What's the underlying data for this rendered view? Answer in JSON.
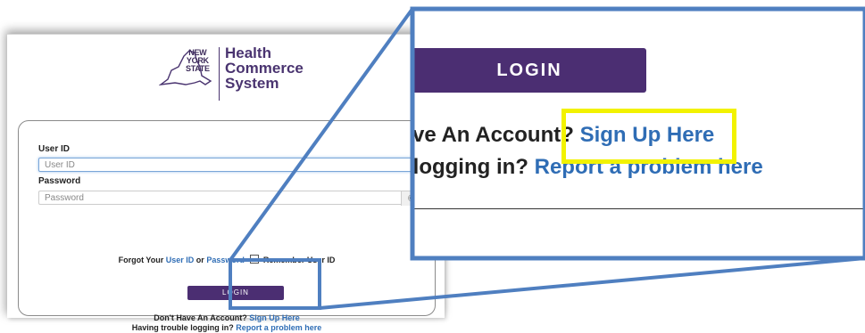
{
  "logo": {
    "state_lines": [
      "NEW",
      "YORK",
      "STATE"
    ],
    "title_lines": [
      "Health",
      "Commerce",
      "System"
    ]
  },
  "form": {
    "user_id_label": "User ID",
    "user_id_placeholder": "User ID",
    "password_label": "Password",
    "password_placeholder": "Password",
    "forgot_prefix": "Forgot Your",
    "forgot_user_id_link": "User ID",
    "forgot_or": "or",
    "forgot_password_link": "Password",
    "remember_label": "Remember User ID",
    "login_label": "LOGIN",
    "no_account_text": "Don't Have An Account?",
    "sign_up_link": "Sign Up Here",
    "trouble_text": "Having trouble logging in?",
    "report_link": "Report a problem here"
  },
  "zoom": {
    "login_label": "LOGIN",
    "line1_text": "ve An Account?",
    "sign_up_link": "Sign Up Here",
    "line2_text": "- logging in?",
    "report_link": "Report a problem here"
  },
  "colors": {
    "brand_purple": "#4b2e72",
    "link_blue": "#2f6db5",
    "callout_blue": "#4f7fc0",
    "highlight_yellow": "#f2f200"
  },
  "icons": {
    "password_toggle": "eye-icon"
  }
}
